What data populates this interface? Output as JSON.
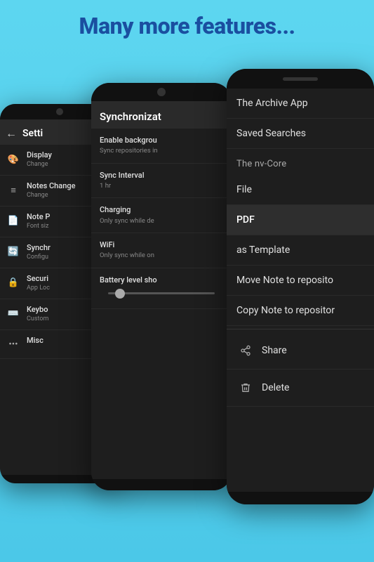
{
  "header": {
    "title": "Many more features..."
  },
  "phone_settings": {
    "title": "Setti",
    "back_label": "←",
    "items": [
      {
        "icon": "🎨",
        "label": "Display",
        "sub": "Change"
      },
      {
        "icon": "≡",
        "label": "Notes Change",
        "sub": "Change"
      },
      {
        "icon": "📄",
        "label": "Note P",
        "sub": "Font siz"
      },
      {
        "icon": "🔄",
        "label": "Synchr",
        "sub": "Configu"
      },
      {
        "icon": "🔒",
        "label": "Securi",
        "sub": "App Loc"
      },
      {
        "icon": "⌨️",
        "label": "Keybo",
        "sub": "Custom"
      },
      {
        "icon": "•••",
        "label": "Misc",
        "sub": ""
      }
    ]
  },
  "phone_sync": {
    "title": "Synchronizat",
    "items": [
      {
        "label": "Enable backgrou",
        "sub": "Sync repositories in"
      },
      {
        "label": "Sync Interval",
        "sub": "1 hr"
      },
      {
        "label": "Charging",
        "sub": "Only sync while de"
      },
      {
        "label": "WiFi",
        "sub": "Only sync while on"
      },
      {
        "label": "Battery level sho",
        "sub": ""
      }
    ]
  },
  "phone_menu": {
    "sections": [
      {
        "header": "",
        "items": [
          {
            "label": "The Archive App",
            "icon": "",
            "active": false
          },
          {
            "label": "Saved Searches",
            "icon": "",
            "active": false
          }
        ]
      },
      {
        "header": "The nv-Core",
        "items": [
          {
            "label": "File",
            "icon": "",
            "active": false
          },
          {
            "label": "PDF",
            "icon": "",
            "active": true
          },
          {
            "label": "as Template",
            "icon": "",
            "active": false
          },
          {
            "label": "Move Note to reposito",
            "icon": "",
            "active": false
          },
          {
            "label": "Copy Note to repositor",
            "icon": "",
            "active": false
          }
        ]
      },
      {
        "header": "",
        "items": [
          {
            "label": "Share",
            "icon": "share",
            "active": false
          },
          {
            "label": "Delete",
            "icon": "delete",
            "active": false
          }
        ]
      }
    ]
  }
}
